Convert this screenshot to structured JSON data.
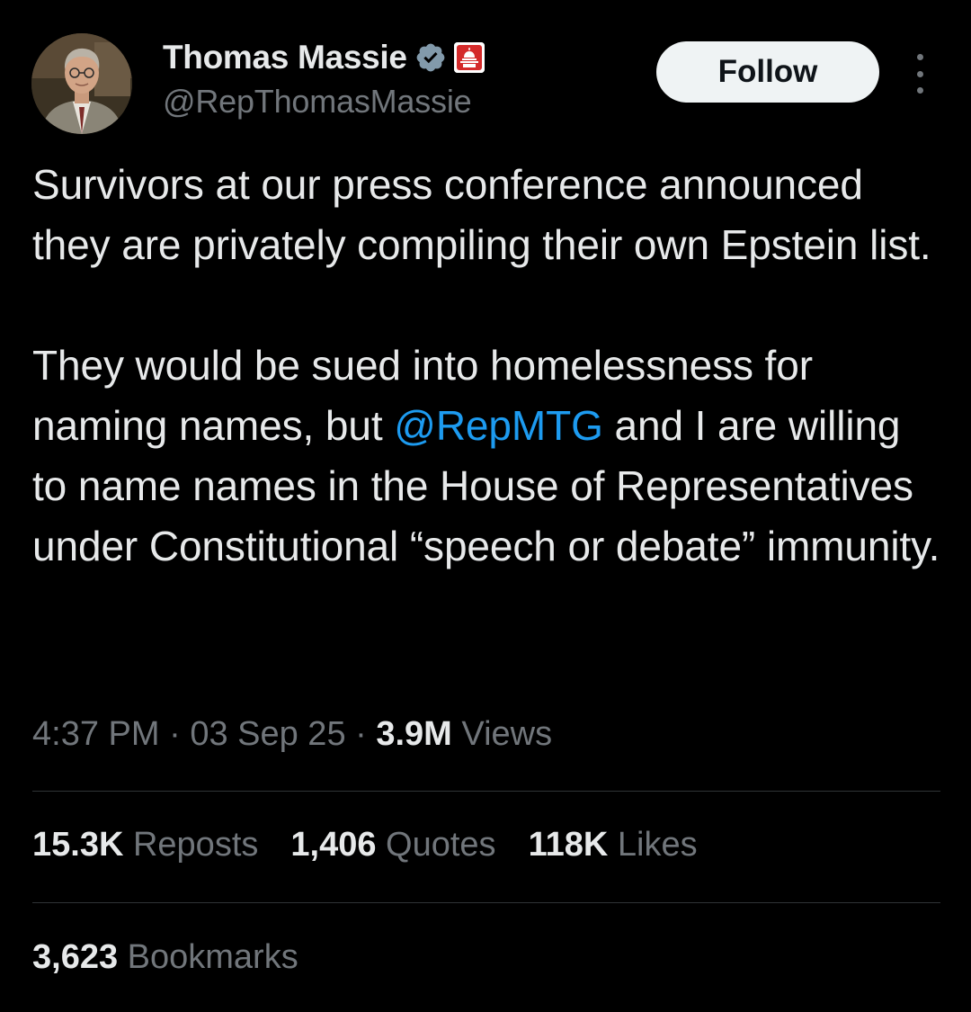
{
  "author": {
    "display_name": "Thomas Massie",
    "handle": "@RepThomasMassie",
    "verified_icon": "verified-badge-icon",
    "affiliation_icon": "capitol-icon"
  },
  "actions": {
    "follow_label": "Follow",
    "more_icon": "more-vertical-icon"
  },
  "tweet": {
    "paragraph1": "Survivors at our press conference announced they are privately compiling their own Epstein list.",
    "paragraph2_before": "They would be sued into homelessness for naming names, but ",
    "mention": "@RepMTG",
    "paragraph2_after": " and I are willing to name names in the House of Representatives under Constitutional “speech or debate” immunity."
  },
  "meta": {
    "time": "4:37 PM",
    "separator": "·",
    "date": "03 Sep 25",
    "views_count": "3.9M",
    "views_label": "Views"
  },
  "stats": {
    "reposts_count": "15.3K",
    "reposts_label": "Reposts",
    "quotes_count": "1,406",
    "quotes_label": "Quotes",
    "likes_count": "118K",
    "likes_label": "Likes",
    "bookmarks_count": "3,623",
    "bookmarks_label": "Bookmarks"
  },
  "colors": {
    "background": "#000000",
    "text_primary": "#e7e9ea",
    "text_secondary": "#71767b",
    "link": "#1d9bf0",
    "verified": "#829aab",
    "affiliation_red": "#d42a2a",
    "divider": "#2f3336"
  }
}
